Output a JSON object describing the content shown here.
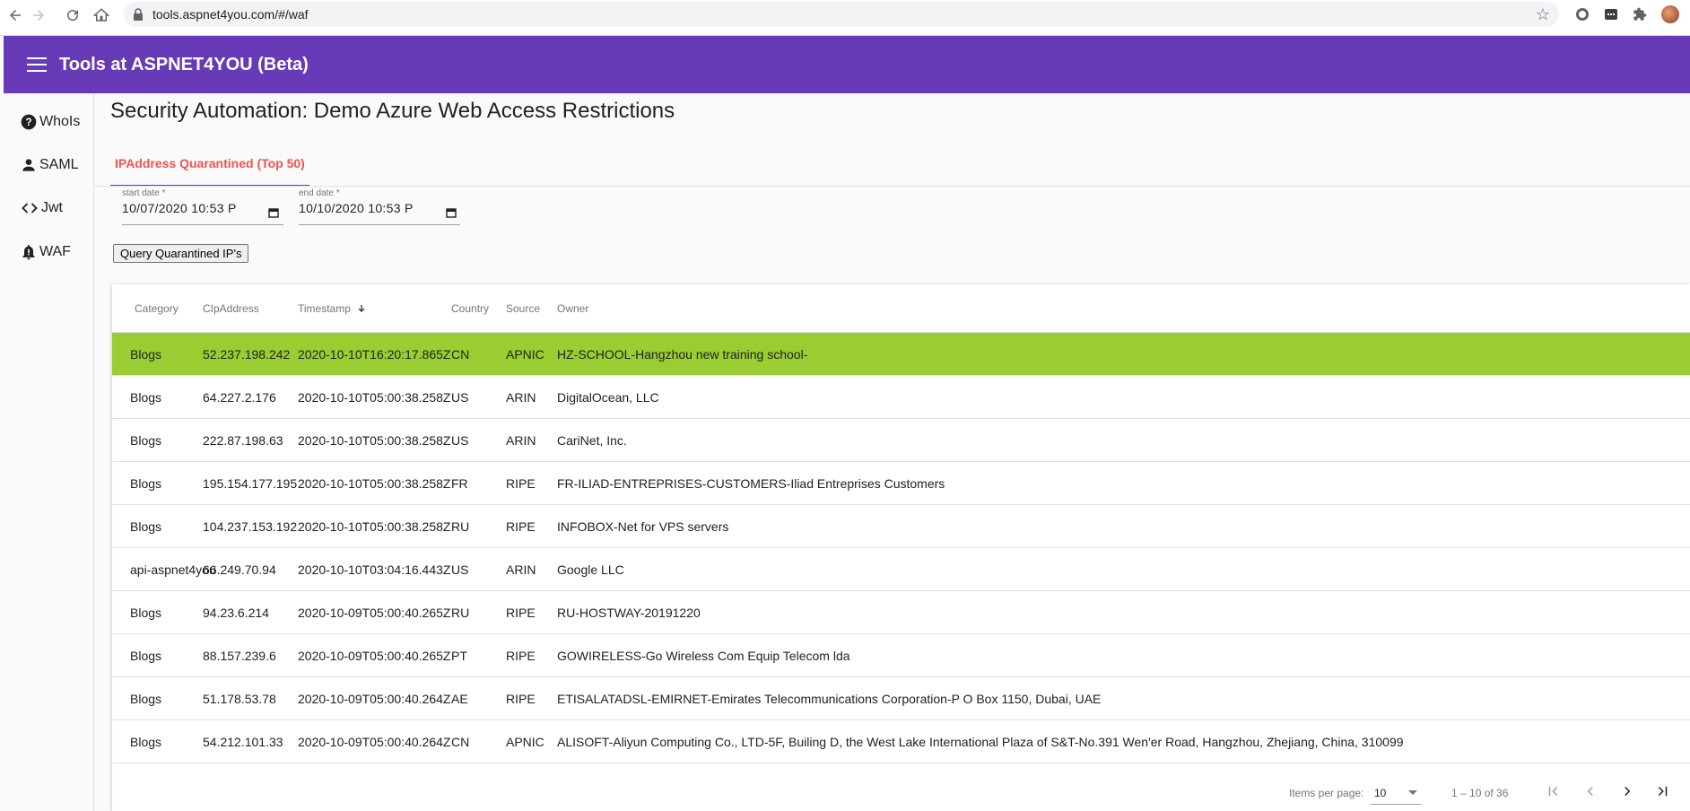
{
  "browser": {
    "url": "tools.aspnet4you.com/#/waf"
  },
  "toolbar": {
    "title": "Tools at ASPNET4YOU (Beta)"
  },
  "sidebar": {
    "items": [
      {
        "label": "WhoIs",
        "icon": "help-circle-icon"
      },
      {
        "label": "SAML",
        "icon": "person-icon"
      },
      {
        "label": "Jwt",
        "icon": "code-icon"
      },
      {
        "label": "WAF",
        "icon": "bell-alert-icon"
      }
    ]
  },
  "page": {
    "title": "Security Automation: Demo Azure Web Access Restrictions"
  },
  "tabs": [
    {
      "label": "IPAddress Quarantined (Top 50)",
      "active": true
    }
  ],
  "form": {
    "start_label": "start date *",
    "start_value": "10/07/2020 10:53 P",
    "end_label": "end date *",
    "end_value": "10/10/2020 10:53 P",
    "query_button": "Query Quarantined IP's"
  },
  "table": {
    "columns": [
      "Category",
      "CIpAddress",
      "Timestamp",
      "Country",
      "Source",
      "Owner"
    ],
    "rows": [
      {
        "category": "Blogs",
        "ip": "52.237.198.242",
        "timestamp": "2020-10-10T16:20:17.865Z",
        "country": "CN",
        "source": "APNIC",
        "owner": "HZ-SCHOOL-Hangzhou new training school-"
      },
      {
        "category": "Blogs",
        "ip": "64.227.2.176",
        "timestamp": "2020-10-10T05:00:38.258Z",
        "country": "US",
        "source": "ARIN",
        "owner": "DigitalOcean, LLC"
      },
      {
        "category": "Blogs",
        "ip": "222.87.198.63",
        "timestamp": "2020-10-10T05:00:38.258Z",
        "country": "US",
        "source": "ARIN",
        "owner": "CariNet, Inc."
      },
      {
        "category": "Blogs",
        "ip": "195.154.177.195",
        "timestamp": "2020-10-10T05:00:38.258Z",
        "country": "FR",
        "source": "RIPE",
        "owner": "FR-ILIAD-ENTREPRISES-CUSTOMERS-Iliad Entreprises Customers"
      },
      {
        "category": "Blogs",
        "ip": "104.237.153.192",
        "timestamp": "2020-10-10T05:00:38.258Z",
        "country": "RU",
        "source": "RIPE",
        "owner": "INFOBOX-Net for VPS servers"
      },
      {
        "category": "api-aspnet4you",
        "ip": "66.249.70.94",
        "timestamp": "2020-10-10T03:04:16.443Z",
        "country": "US",
        "source": "ARIN",
        "owner": "Google LLC"
      },
      {
        "category": "Blogs",
        "ip": "94.23.6.214",
        "timestamp": "2020-10-09T05:00:40.265Z",
        "country": "RU",
        "source": "RIPE",
        "owner": "RU-HOSTWAY-20191220"
      },
      {
        "category": "Blogs",
        "ip": "88.157.239.6",
        "timestamp": "2020-10-09T05:00:40.265Z",
        "country": "PT",
        "source": "RIPE",
        "owner": "GOWIRELESS-Go Wireless Com Equip Telecom lda"
      },
      {
        "category": "Blogs",
        "ip": "51.178.53.78",
        "timestamp": "2020-10-09T05:00:40.264Z",
        "country": "AE",
        "source": "RIPE",
        "owner": "ETISALATADSL-EMIRNET-Emirates Telecommunications Corporation-P O Box 1150, Dubai, UAE"
      },
      {
        "category": "Blogs",
        "ip": "54.212.101.33",
        "timestamp": "2020-10-09T05:00:40.264Z",
        "country": "CN",
        "source": "APNIC",
        "owner": "ALISOFT-Aliyun Computing Co., LTD-5F, Builing D, the West Lake International Plaza of S&T-No.391 Wen'er Road, Hangzhou, Zhejiang, China, 310099"
      }
    ]
  },
  "paginator": {
    "items_per_page_label": "Items per page:",
    "page_size": "10",
    "range": "1 – 10 of 36"
  },
  "colors": {
    "toolbar": "#673ab7",
    "highlight_row": "#9acd32",
    "active_tab_text": "#ef5350",
    "active_tab_underline": "#3f51b5"
  }
}
